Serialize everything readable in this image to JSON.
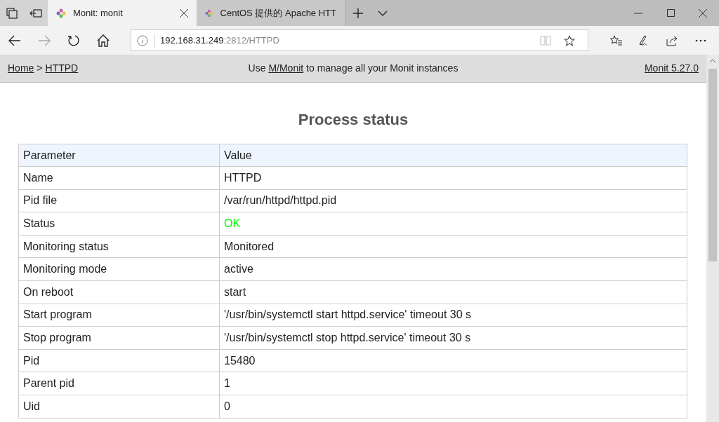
{
  "browser": {
    "tabs": [
      {
        "title": "Monit: monit",
        "selected": true
      },
      {
        "title": "CentOS 提供的 Apache HTT",
        "selected": false
      }
    ],
    "address": {
      "host": "192.168.31.249",
      "path": ":2812/HTTPD"
    }
  },
  "header": {
    "breadcrumb": [
      {
        "label": "Home"
      },
      {
        "label": "HTTPD"
      }
    ],
    "separator": ">",
    "banner_before": "Use ",
    "banner_link": "M/Monit",
    "banner_after": " to manage all your Monit instances",
    "version": "Monit 5.27.0"
  },
  "title": "Process status",
  "table": {
    "columns": [
      "Parameter",
      "Value"
    ],
    "rows": [
      {
        "parameter": "Name",
        "value": "HTTPD"
      },
      {
        "parameter": "Pid file",
        "value": "/var/run/httpd/httpd.pid"
      },
      {
        "parameter": "Status",
        "value": "OK",
        "color": "#00ff00"
      },
      {
        "parameter": "Monitoring status",
        "value": "Monitored"
      },
      {
        "parameter": "Monitoring mode",
        "value": "active"
      },
      {
        "parameter": "On reboot",
        "value": "start"
      },
      {
        "parameter": "Start program",
        "value": "'/usr/bin/systemctl start httpd.service' timeout 30 s"
      },
      {
        "parameter": "Stop program",
        "value": "'/usr/bin/systemctl stop httpd.service' timeout 30 s"
      },
      {
        "parameter": "Pid",
        "value": "15480"
      },
      {
        "parameter": "Parent pid",
        "value": "1"
      },
      {
        "parameter": "Uid",
        "value": "0"
      }
    ]
  }
}
